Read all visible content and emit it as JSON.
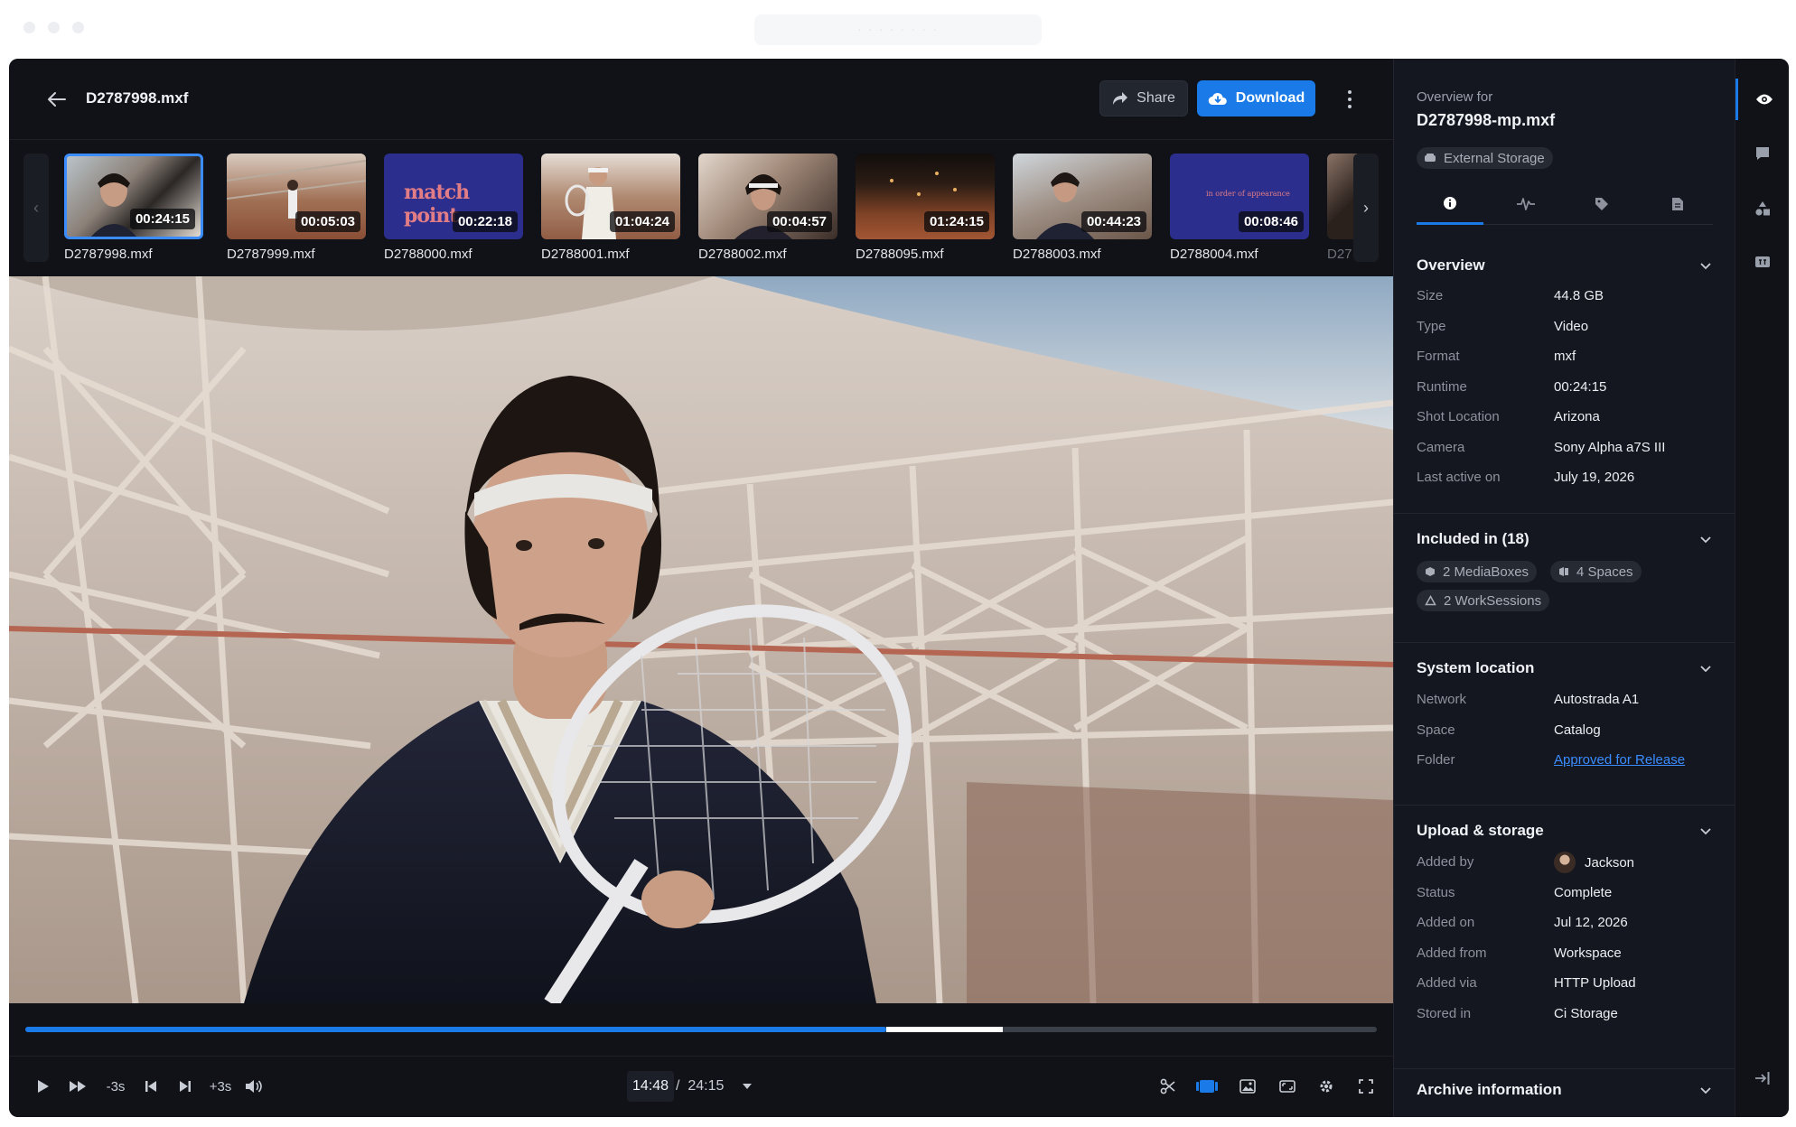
{
  "window": {
    "url_text": "· · · · · · · ·"
  },
  "header": {
    "title": "D2787998.mxf",
    "share_label": "Share",
    "download_label": "Download"
  },
  "filmstrip": [
    {
      "name": "D2787998.mxf",
      "duration": "00:24:15",
      "selected": true
    },
    {
      "name": "D2787999.mxf",
      "duration": "00:05:03",
      "selected": false
    },
    {
      "name": "D2788000.mxf",
      "duration": "00:22:18",
      "selected": false,
      "overlay_text": "match point"
    },
    {
      "name": "D2788001.mxf",
      "duration": "01:04:24",
      "selected": false
    },
    {
      "name": "D2788002.mxf",
      "duration": "00:04:57",
      "selected": false
    },
    {
      "name": "D2788095.mxf",
      "duration": "01:24:15",
      "selected": false
    },
    {
      "name": "D2788003.mxf",
      "duration": "00:44:23",
      "selected": false
    },
    {
      "name": "D2788004.mxf",
      "duration": "00:08:46",
      "selected": false,
      "overlay_text": "in order of appearance"
    },
    {
      "name": "D27",
      "duration": "",
      "selected": false
    }
  ],
  "player": {
    "progress": 0.637,
    "buffered": 0.723,
    "skip_back_label": "-3s",
    "skip_forward_label": "+3s",
    "current_time": "14:48",
    "time_separator": "/",
    "total_time": "24:15"
  },
  "panel": {
    "overview_for_label": "Overview for",
    "file_name": "D2787998-mp.mxf",
    "storage_chip": "External Storage",
    "tabs": [
      "info-icon",
      "waveform-icon",
      "tag-icon",
      "document-icon"
    ],
    "overview": {
      "title": "Overview",
      "rows": [
        {
          "label": "Size",
          "value": "44.8 GB"
        },
        {
          "label": "Type",
          "value": "Video"
        },
        {
          "label": "Format",
          "value": "mxf"
        },
        {
          "label": "Runtime",
          "value": "00:24:15"
        },
        {
          "label": "Shot Location",
          "value": "Arizona"
        },
        {
          "label": "Camera",
          "value": "Sony Alpha a7S III"
        },
        {
          "label": "Last active on",
          "value": "July 19, 2026"
        }
      ]
    },
    "included": {
      "title": "Included in (18)",
      "pills": [
        "2 MediaBoxes",
        "4 Spaces",
        "2 WorkSessions"
      ]
    },
    "system_location": {
      "title": "System location",
      "rows": [
        {
          "label": "Network",
          "value": "Autostrada A1"
        },
        {
          "label": "Space",
          "value": "Catalog"
        },
        {
          "label": "Folder",
          "value": "Approved for Release"
        }
      ]
    },
    "upload_storage": {
      "title": "Upload & storage",
      "rows": [
        {
          "label": "Added by",
          "value": "Jackson"
        },
        {
          "label": "Status",
          "value": "Complete"
        },
        {
          "label": "Added on",
          "value": "Jul 12, 2026"
        },
        {
          "label": "Added from",
          "value": "Workspace"
        },
        {
          "label": "Added via",
          "value": "HTTP Upload"
        },
        {
          "label": "Stored in",
          "value": "Ci Storage"
        }
      ]
    },
    "archive": {
      "title": "Archive information"
    }
  },
  "rail": [
    "eye-icon",
    "comment-icon",
    "shapes-icon",
    "captions-icon",
    "collapse-panel-icon"
  ],
  "colors": {
    "accent": "#1a7be8",
    "background": "#101218",
    "panel": "#141720",
    "link": "#3b8cff"
  }
}
